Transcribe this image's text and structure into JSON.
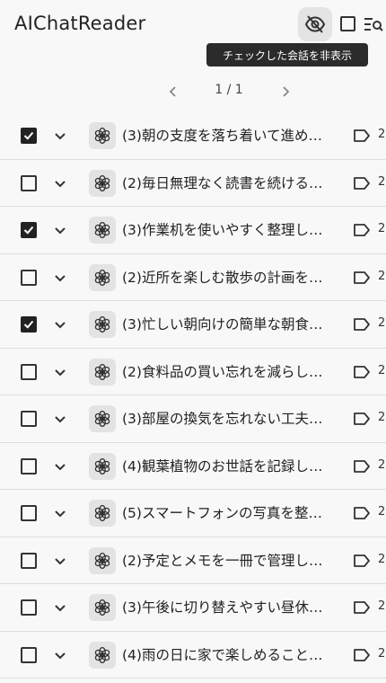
{
  "app": {
    "title": "AIChatReader"
  },
  "toolbar": {
    "tooltip": "チェックした会話を非表示",
    "hide_icon": "eye-off-icon",
    "select_all_icon": "checkbox-icon",
    "filter_icon": "search-filter-icon"
  },
  "pager": {
    "text": "1 / 1"
  },
  "rows": [
    {
      "checked": true,
      "title": "(3)朝の支度を落ち着いて進め…",
      "count": "2"
    },
    {
      "checked": false,
      "title": "(2)毎日無理なく読書を続ける…",
      "count": "2"
    },
    {
      "checked": true,
      "title": "(3)作業机を使いやすく整理し…",
      "count": "2"
    },
    {
      "checked": false,
      "title": "(2)近所を楽しむ散歩の計画を…",
      "count": "2"
    },
    {
      "checked": true,
      "title": "(3)忙しい朝向けの簡単な朝食…",
      "count": "2"
    },
    {
      "checked": false,
      "title": "(2)食料品の買い忘れを減らし…",
      "count": "2"
    },
    {
      "checked": false,
      "title": "(3)部屋の換気を忘れない工夫…",
      "count": "2"
    },
    {
      "checked": false,
      "title": "(4)観葉植物のお世話を記録し…",
      "count": "2"
    },
    {
      "checked": false,
      "title": "(5)スマートフォンの写真を整…",
      "count": "2"
    },
    {
      "checked": false,
      "title": "(2)予定とメモを一冊で管理し…",
      "count": "2"
    },
    {
      "checked": false,
      "title": "(3)午後に切り替えやすい昼休…",
      "count": "2"
    },
    {
      "checked": false,
      "title": "(4)雨の日に家で楽しめること…",
      "count": "2"
    }
  ]
}
